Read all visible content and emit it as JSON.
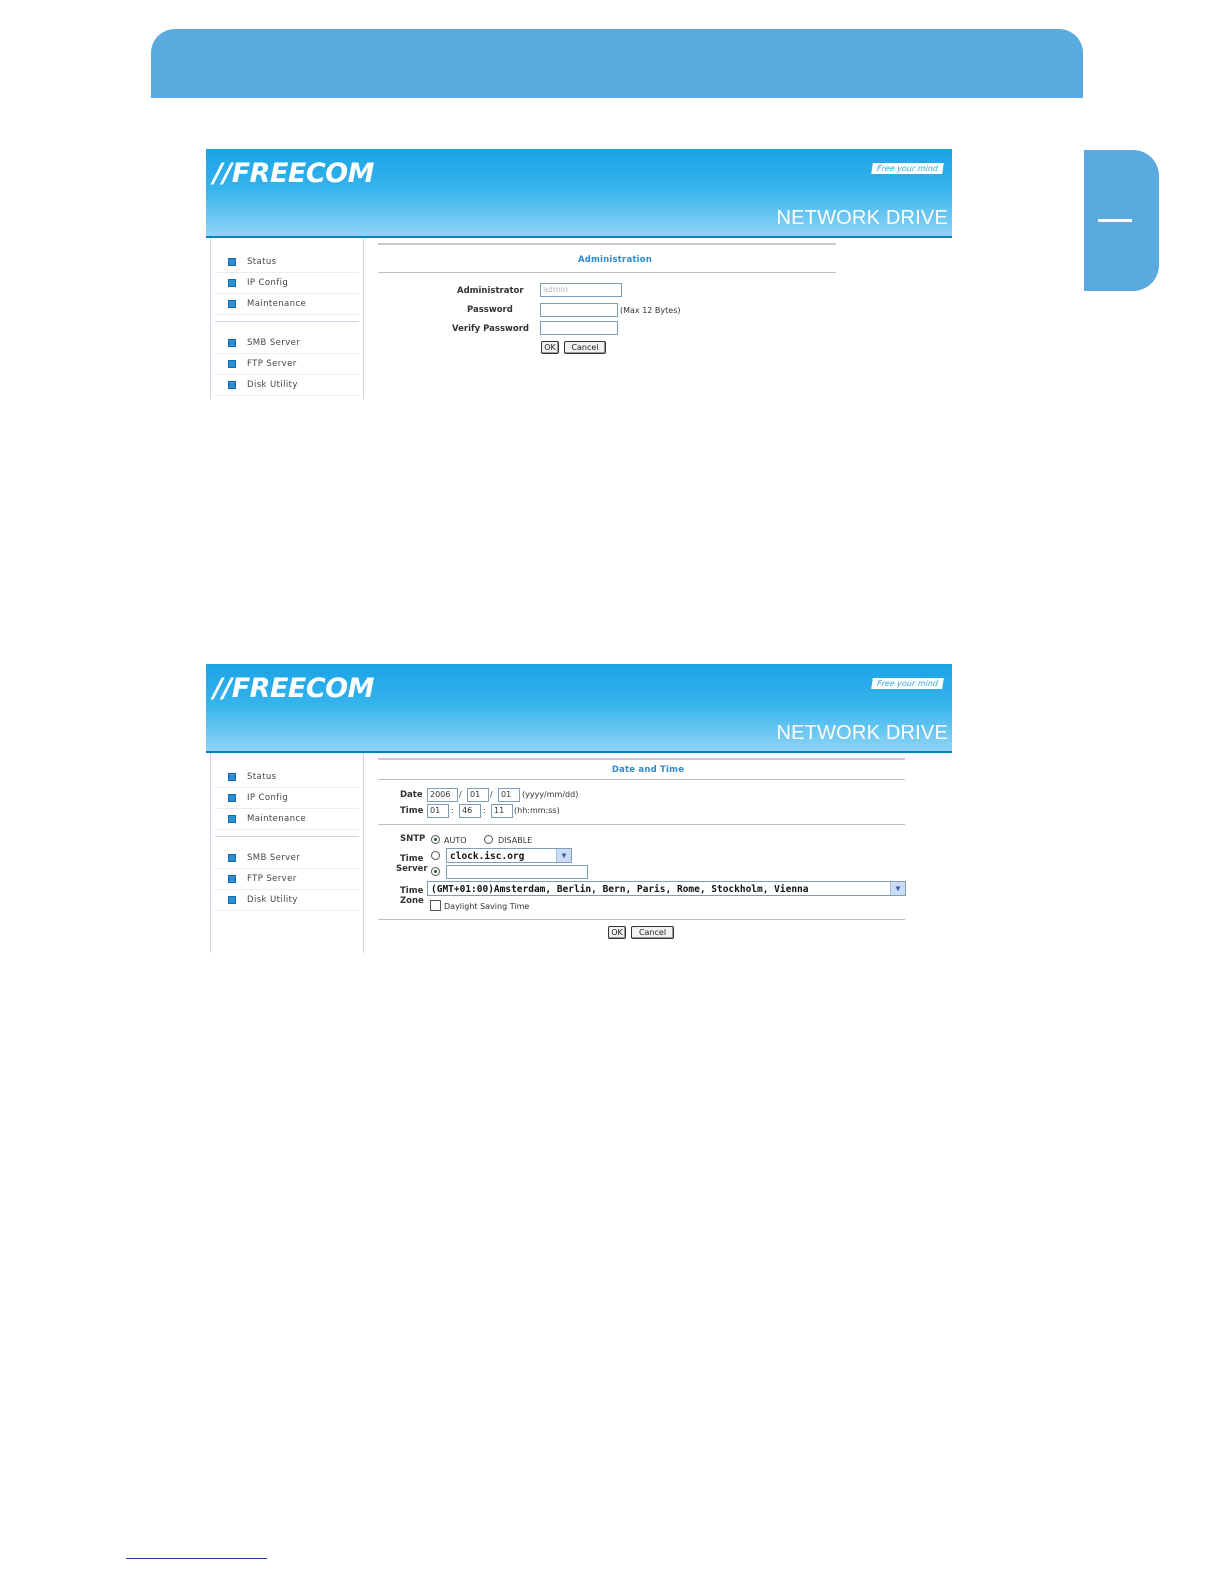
{
  "page": {
    "accent_color": "#5aaadf",
    "side_tab_mark": "—"
  },
  "brand": {
    "logo": "//FREECOM",
    "slogan": "Free your mind",
    "product": "NETWORK DRIVE"
  },
  "menu": {
    "group1": [
      "Status",
      "IP Config",
      "Maintenance"
    ],
    "group2": [
      "SMB Server",
      "FTP Server",
      "Disk Utility"
    ]
  },
  "admin_panel": {
    "title": "Administration",
    "administrator_label": "Administrator",
    "administrator_placeholder": "admin",
    "password_label": "Password",
    "password_note": "(Max 12 Bytes)",
    "verify_label": "Verify Password",
    "ok": "OK",
    "cancel": "Cancel"
  },
  "datetime_panel": {
    "title": "Date and Time",
    "date_label": "Date",
    "date_year": "2006",
    "date_month": "01",
    "date_day": "01",
    "date_sep": "/",
    "date_format": "(yyyy/mm/dd)",
    "time_label": "Time",
    "time_hh": "01",
    "time_mm": "46",
    "time_ss": "11",
    "time_sep": ":",
    "time_format": "(hh:mm:ss)",
    "sntp_label": "SNTP",
    "sntp_auto": "AUTO",
    "sntp_disable": "DISABLE",
    "time_server_label_1": "Time",
    "time_server_label_2": "Server",
    "time_server_value": "clock.isc.org",
    "timezone_label_1": "Time",
    "timezone_label_2": "Zone",
    "timezone_value": "(GMT+01:00)Amsterdam, Berlin, Bern, Paris, Rome, Stockholm, Vienna",
    "dst_label": "Daylight Saving Time",
    "ok": "OK",
    "cancel": "Cancel"
  }
}
